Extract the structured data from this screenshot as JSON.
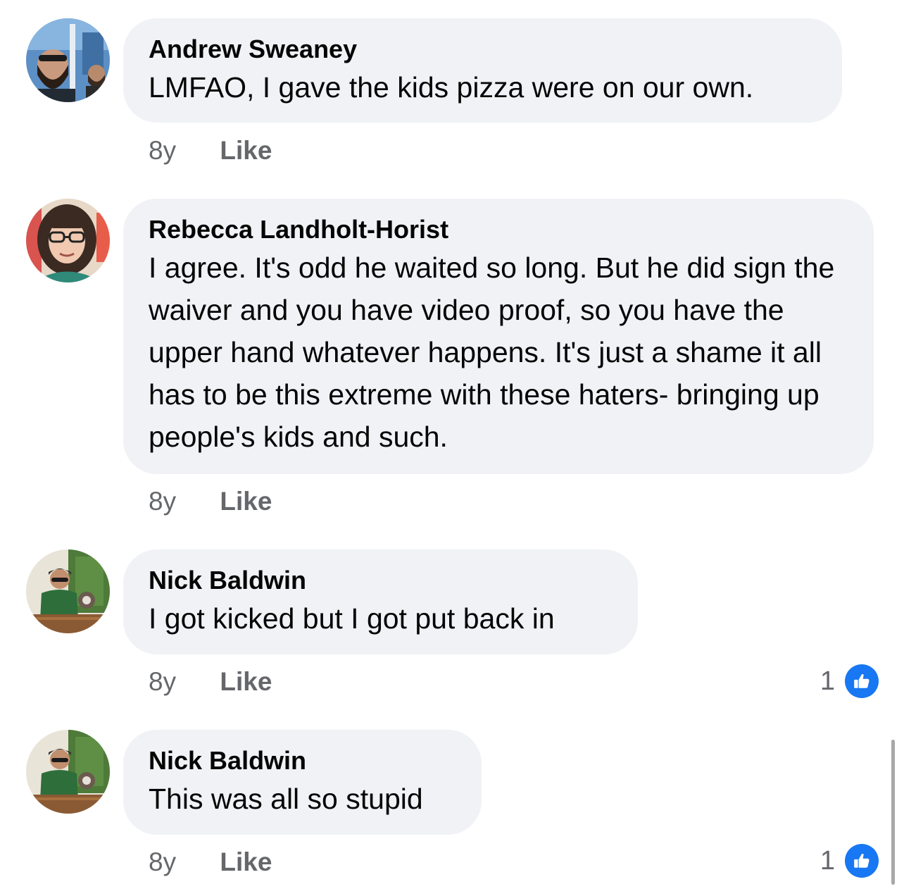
{
  "comments": [
    {
      "author": "Andrew Sweaney",
      "text": "LMFAO, I gave the kids pizza were on our own.",
      "time": "8y",
      "like_label": "Like",
      "avatar_icon": "profile-photo-bearded-man"
    },
    {
      "author": "Rebecca Landholt-Horist",
      "text": "I agree. It's odd he waited so long. But he did sign the waiver and you have video proof, so you have the upper hand whatever happens. It's just a shame it all has to be this extreme with these haters- bringing up people's kids and such.",
      "time": "8y",
      "like_label": "Like",
      "avatar_icon": "profile-photo-woman-glasses"
    },
    {
      "author": "Nick Baldwin",
      "text": "I got kicked but I got put back in",
      "time": "8y",
      "like_label": "Like",
      "reaction_count": "1",
      "reaction_icon": "thumbs-up-icon",
      "avatar_icon": "profile-photo-man-with-dog"
    },
    {
      "author": "Nick Baldwin",
      "text": "This was all so stupid",
      "time": "8y",
      "like_label": "Like",
      "reaction_count": "1",
      "reaction_icon": "thumbs-up-icon",
      "avatar_icon": "profile-photo-man-with-dog"
    }
  ],
  "colors": {
    "bubble_bg": "#f0f2f5",
    "meta_text": "#65676b",
    "like_blue": "#1877f2"
  }
}
